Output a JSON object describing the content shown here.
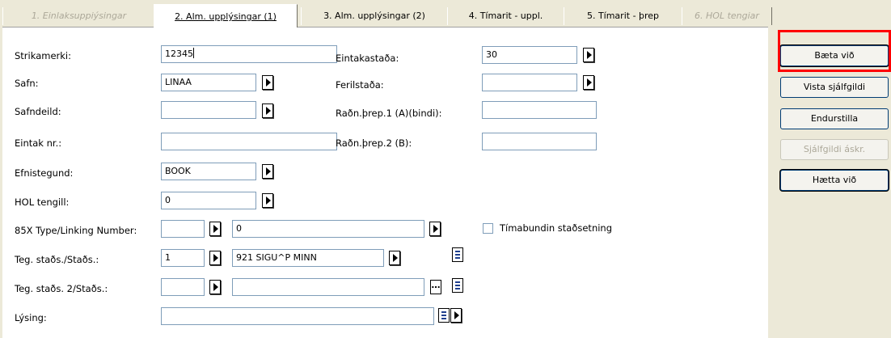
{
  "tabs": [
    {
      "label": "1. Einlaksuppiýsingar",
      "state": "disabled"
    },
    {
      "label": "2. Alm. upplýsingar (1)",
      "state": "active"
    },
    {
      "label": "3. Alm. upplýsingar (2)",
      "state": "normal"
    },
    {
      "label": "4. Tímarit - uppl.",
      "state": "normal"
    },
    {
      "label": "5. Tímarit - þrep",
      "state": "normal"
    },
    {
      "label": "6. HOL tengiar",
      "state": "disabled"
    }
  ],
  "form": {
    "barcode": {
      "label": "Strikamerki:",
      "value": "12345"
    },
    "library": {
      "label": "Safn:",
      "value": "LINAA"
    },
    "sublibrary": {
      "label": "Safndeild:",
      "value": ""
    },
    "copy_no": {
      "label": "Eintak nr.:",
      "value": ""
    },
    "material_type": {
      "label": "Efnistegund:",
      "value": "BOOK"
    },
    "hol_link": {
      "label": "HOL tengill:",
      "value": "0"
    },
    "type_85x": {
      "label": "85X Type/Linking Number:",
      "value1": "",
      "value2": "0"
    },
    "call_no": {
      "label": "Teg. staðs./Staðs.:",
      "type": "1",
      "value": "921 SIGU^P MINN"
    },
    "call_no2": {
      "label": "Teg. staðs. 2/Staðs.:",
      "type": "",
      "value": ""
    },
    "description": {
      "label": "Lýsing:",
      "value": ""
    },
    "item_status": {
      "label": "Eintakastaða:",
      "value": "30"
    },
    "process_status": {
      "label": "Ferilstaða:",
      "value": ""
    },
    "enum_a": {
      "label": "Raðn.þrep.1 (A)(bindi):",
      "value": ""
    },
    "enum_b": {
      "label": "Raðn.þrep.2 (B):",
      "value": ""
    },
    "temp_location": {
      "label": "Tímabundin staðsetning",
      "checked": false
    }
  },
  "buttons": {
    "add": "Bæta við",
    "show_defaults": "Vista sjálfgildi",
    "reset": "Endurstilla",
    "default_desc": "Sjálfgildi áskr.",
    "cancel": "Hætta við"
  },
  "colors": {
    "highlight": "#ff0000",
    "background": "#ece9d8",
    "field_border": "#7f9db9"
  }
}
